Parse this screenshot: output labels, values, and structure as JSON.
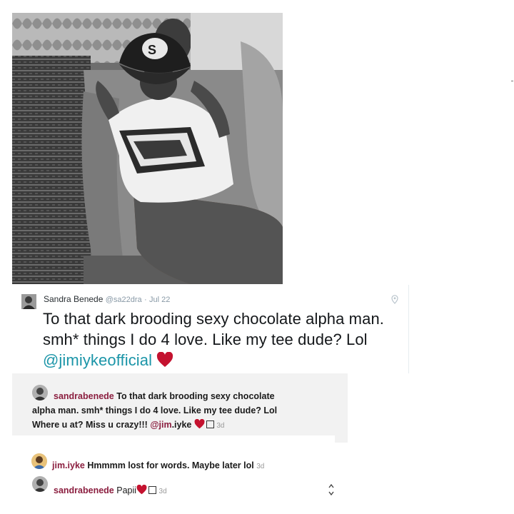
{
  "photo": {
    "alt": "black and white photo of a person in a cap and graphic tee seated on a couch"
  },
  "tweet": {
    "name": "Sandra Benede",
    "handle": "@sa22dra",
    "separator": "·",
    "date": "Jul 22",
    "text_before": "To that dark brooding sexy chocolate alpha man. smh* things I do 4 love. Like my tee dude? Lol ",
    "mention": "@jimiykeofficial",
    "heart_color": "#c4122f",
    "mention_color": "#1b95a8"
  },
  "comments": [
    {
      "user": "sandrabenede",
      "text_1": " To that dark brooding sexy chocolate",
      "text_2": "alpha man. smh* things I do 4 love. Like my tee dude? Lol",
      "text_3": "Where u at? Miss u crazy!!! ",
      "mention": "@jim",
      "mention_rest": ".iyke",
      "time": "3d"
    },
    {
      "user": "jim.iyke",
      "text": " Hmmmm lost for words. Maybe later lol",
      "time": "3d"
    },
    {
      "user": "sandrabenede",
      "text": " Papii",
      "time": "3d"
    }
  ],
  "colors": {
    "username": "#8b1e3f",
    "panel_bg": "#f2f2f2"
  }
}
